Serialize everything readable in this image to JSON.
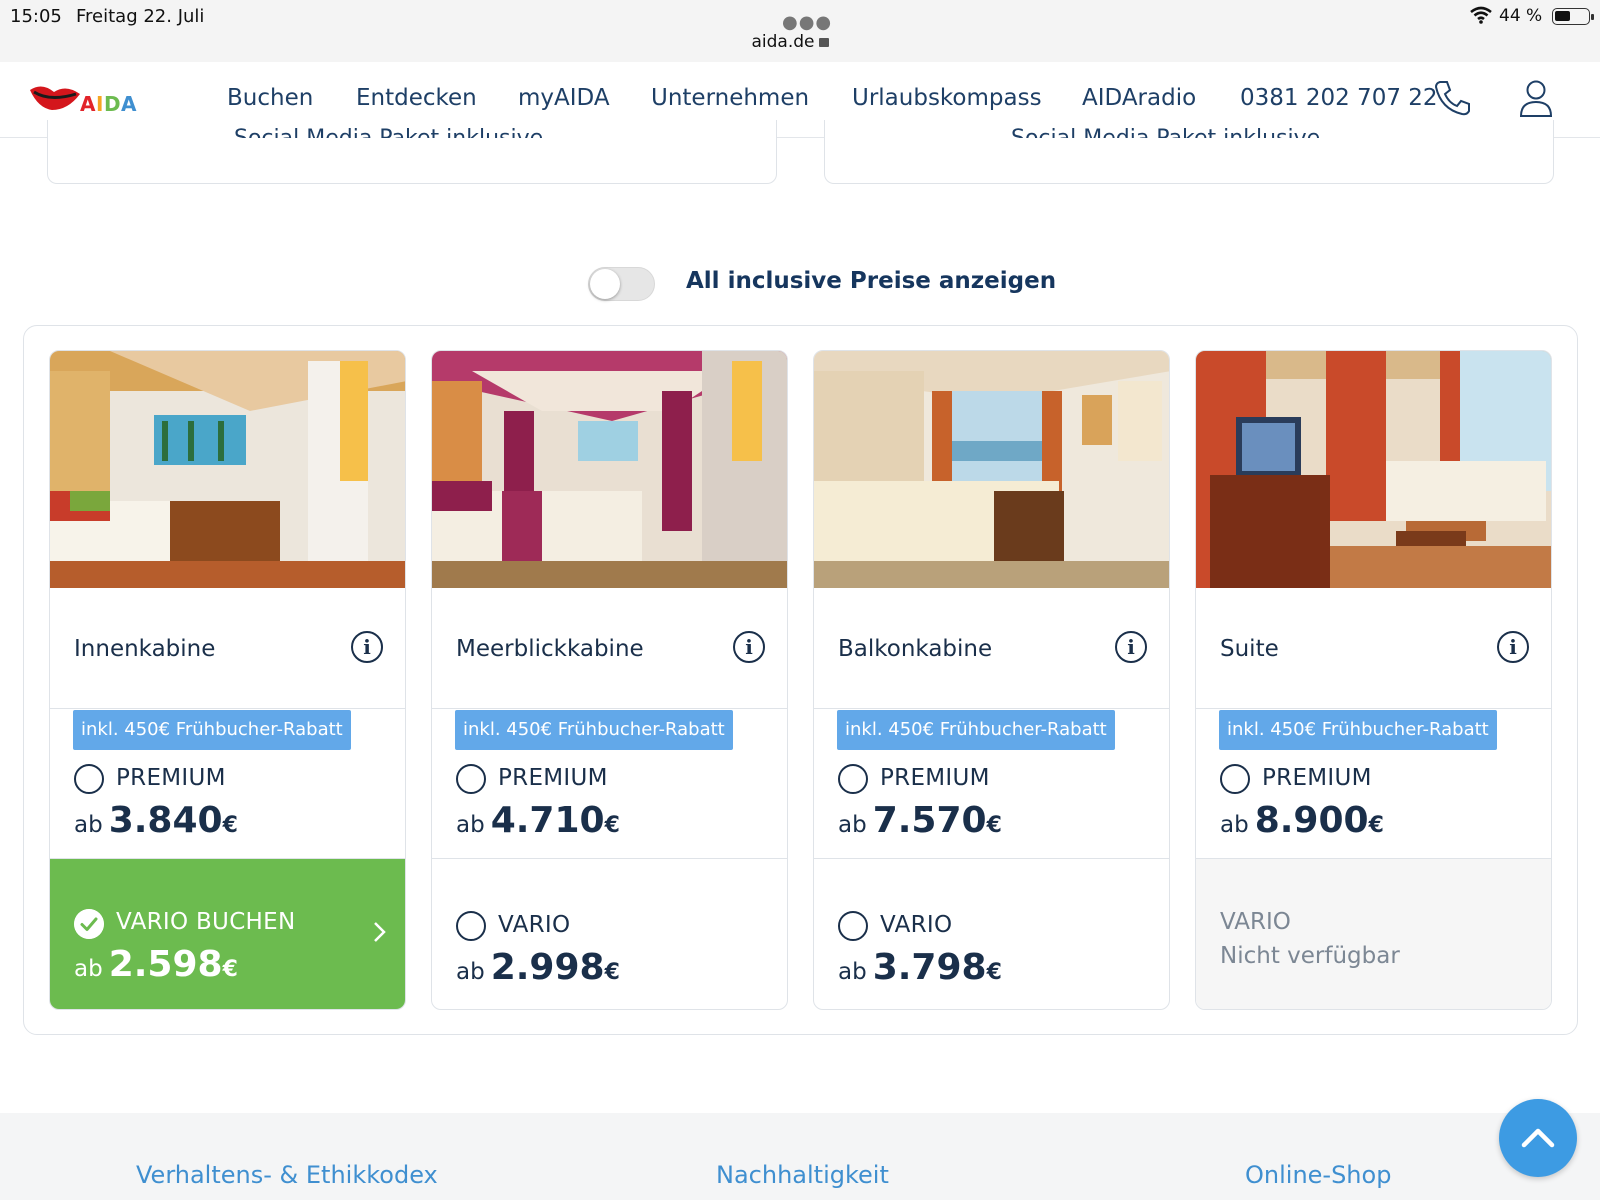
{
  "status_bar": {
    "time": "15:05",
    "date": "Freitag 22. Juli",
    "url": "aida.de",
    "battery": "44 %"
  },
  "nav": {
    "logo_text": "AIDA",
    "items": [
      "Buchen",
      "Entdecken",
      "myAIDA",
      "Unternehmen",
      "Urlaubskompass",
      "AIDAradio"
    ],
    "phone": "0381 202 707 22"
  },
  "top_cards": {
    "item_text": "Social Media Paket inklusive"
  },
  "toggle": {
    "label": "All inclusive Preise anzeigen",
    "on": false
  },
  "cabins": [
    {
      "name": "Innenkabine",
      "badge": "inkl. 450€ Frühbucher-Rabatt",
      "premium_label": "PREMIUM",
      "premium_prefix": "ab",
      "premium_price": "3.840",
      "currency": "€",
      "vario_label": "VARIO BUCHEN",
      "vario_prefix": "ab",
      "vario_price": "2.598",
      "vario_state": "selected"
    },
    {
      "name": "Meerblickkabine",
      "badge": "inkl. 450€ Frühbucher-Rabatt",
      "premium_label": "PREMIUM",
      "premium_prefix": "ab",
      "premium_price": "4.710",
      "currency": "€",
      "vario_label": "VARIO",
      "vario_prefix": "ab",
      "vario_price": "2.998",
      "vario_state": "available"
    },
    {
      "name": "Balkonkabine",
      "badge": "inkl. 450€ Frühbucher-Rabatt",
      "premium_label": "PREMIUM",
      "premium_prefix": "ab",
      "premium_price": "7.570",
      "currency": "€",
      "vario_label": "VARIO",
      "vario_prefix": "ab",
      "vario_price": "3.798",
      "vario_state": "available"
    },
    {
      "name": "Suite",
      "badge": "inkl. 450€ Frühbucher-Rabatt",
      "premium_label": "PREMIUM",
      "premium_prefix": "ab",
      "premium_price": "8.900",
      "currency": "€",
      "vario_label": "VARIO",
      "vario_unavailable": "Nicht verfügbar",
      "vario_state": "unavailable"
    }
  ],
  "footer": {
    "links": [
      "Verhaltens- & Ethikkodex",
      "Nachhaltigkeit",
      "Online-Shop"
    ]
  },
  "colors": {
    "navy": "#1a2f4a",
    "badge_blue": "#62a8e9",
    "vario_green": "#6cbb4f",
    "link_blue": "#3f8fd0",
    "fab_blue": "#3d9be3"
  }
}
